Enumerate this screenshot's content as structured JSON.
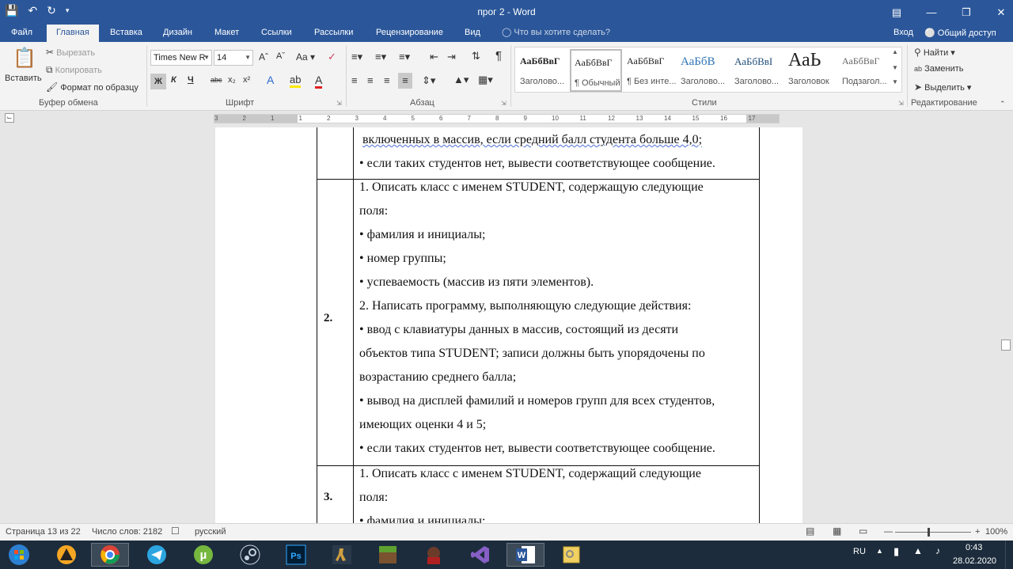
{
  "window": {
    "title": "прог 2 - Word"
  },
  "tabs": [
    "Файл",
    "Главная",
    "Вставка",
    "Дизайн",
    "Макет",
    "Ссылки",
    "Рассылки",
    "Рецензирование",
    "Вид"
  ],
  "tell_me": "Что вы хотите сделать?",
  "login": "Вход",
  "share": "Общий доступ",
  "clipboard": {
    "paste": "Вставить",
    "cut": "Вырезать",
    "copy": "Копировать",
    "format_painter": "Формат по образцу",
    "label": "Буфер обмена"
  },
  "font": {
    "name": "Times New R",
    "size": "14",
    "label": "Шрифт",
    "bold": "Ж",
    "italic": "К",
    "underline": "Ч",
    "strike": "abc",
    "sub": "x₂",
    "sup": "x²"
  },
  "paragraph": {
    "label": "Абзац"
  },
  "styles": {
    "label": "Стили",
    "items": [
      {
        "sample": "АаБбВвГ",
        "name": "Заголово..."
      },
      {
        "sample": "АаБбВвГ",
        "name": "¶ Обычный"
      },
      {
        "sample": "АаБбВвГ",
        "name": "¶ Без инте..."
      },
      {
        "sample": "АаБбВ",
        "name": "Заголово..."
      },
      {
        "sample": "АаБбВвІ",
        "name": "Заголово..."
      },
      {
        "sample": "АаЬ",
        "name": "Заголовок"
      },
      {
        "sample": "АаБбВвГ",
        "name": "Подзагол..."
      }
    ]
  },
  "editing": {
    "find": "Найти",
    "replace": "Заменить",
    "select": "Выделить",
    "label": "Редактирование"
  },
  "document": {
    "top_lines": [
      "включенных  в массив, если средний балл студента больше 4,0;",
      "• если таких студентов нет, вывести соответствующее сообщение."
    ],
    "row2": {
      "number": "2.",
      "lines": [
        "1. Описать класс с именем STUDENT, содержащую следующие",
        "поля:",
        "• фамилия и инициалы;",
        "• номер группы;",
        "• успеваемость (массив из пяти элементов).",
        "2. Написать программу, выполняющую следующие действия:",
        "• ввод с клавиатуры данных в массив, состоящий из десяти",
        "объектов типа STUDENT; записи должны быть упорядочены по",
        "возрастанию среднего  балла;",
        "• вывод на дисплей фамилий и номеров групп для всех студентов,",
        "имеющих  оценки 4 и 5;",
        "• если таких студентов нет, вывести соответствующее сообщение."
      ]
    },
    "row3": {
      "number": "3.",
      "lines": [
        "1. Описать класс с именем STUDENT, содержащий следующие",
        "поля:",
        "• фамилия и инициалы;"
      ]
    }
  },
  "status": {
    "page": "Страница 13 из 22",
    "words": "Число слов: 2182",
    "lang": "русский",
    "zoom": "100%"
  },
  "taskbar": {
    "lang": "RU",
    "time": "0:43",
    "date": "28.02.2020"
  },
  "ruler": {
    "marks": [
      "3",
      "2",
      "1",
      "1",
      "2",
      "3",
      "4",
      "5",
      "6",
      "7",
      "8",
      "9",
      "10",
      "11",
      "12",
      "13",
      "14",
      "15",
      "16",
      "17"
    ]
  }
}
